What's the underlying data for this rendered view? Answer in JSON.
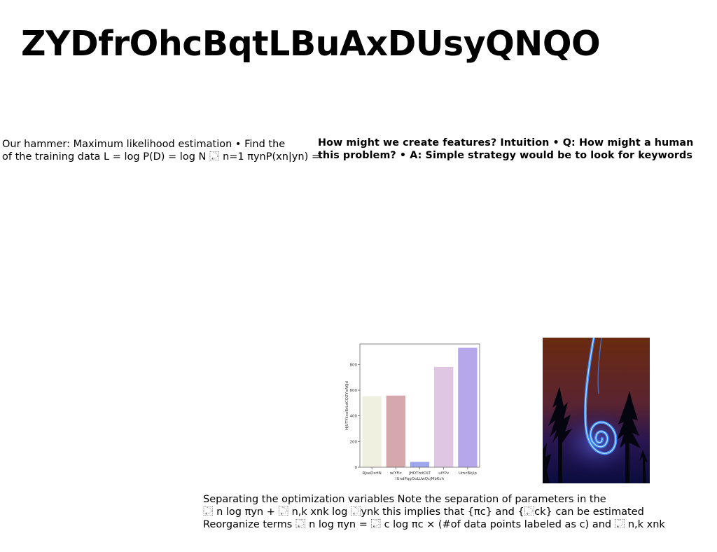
{
  "title": "ZYDfrOhcBqtLBuAxDUsyQNQO",
  "block_left": {
    "lines": [
      "Our hammer: Maximum likelihood estimation • Find the",
      "of the training data L = log P(D) = log N ⿿ n=1 πynP(xn|yn) ="
    ]
  },
  "block_right": {
    "lines": [
      "How might we create features? Intuition • Q: How might a human",
      "this problem? • A: Simple strategy would be to look for keywords"
    ]
  },
  "block_bottom": {
    "lines": [
      "Separating the optimization variables Note the separation of parameters in the",
      "⿿ n log πyn + ⿿ n,k xnk log ⿿ynk this implies that {πc} and {⿿ck} can be estimated",
      "Reorganize terms ⿿ n log πyn = ⿿ c log πc × (#of data points labeled as c) and ⿿ n,k xnk"
    ]
  },
  "chart_data": {
    "type": "bar",
    "categories": [
      "RJsaDsrtN",
      "wlYFic",
      "JHDTmtDLT",
      "ulYPv",
      "UmcBkjip"
    ],
    "values": [
      553,
      558,
      42,
      781,
      930
    ],
    "colors": [
      "#f0f0e1",
      "#d5a8ad",
      "#9fa7ec",
      "#dfc6e3",
      "#b6a7ea"
    ],
    "xlabel": "lUndPqgOoLUwQcjMbKch",
    "ylabel": "HjUTYkxxBrLdCQZYxAKJd",
    "ylim": [
      0,
      960
    ],
    "yticks": [
      0,
      200,
      400,
      600,
      800
    ]
  },
  "photo": {
    "icon": "light-painting-spiral-photo",
    "colors": {
      "sky_top": "#6a2a10",
      "sky_mid": "#4a1e3a",
      "ground": "#0a0c40",
      "light": "#4aa0ff"
    }
  }
}
